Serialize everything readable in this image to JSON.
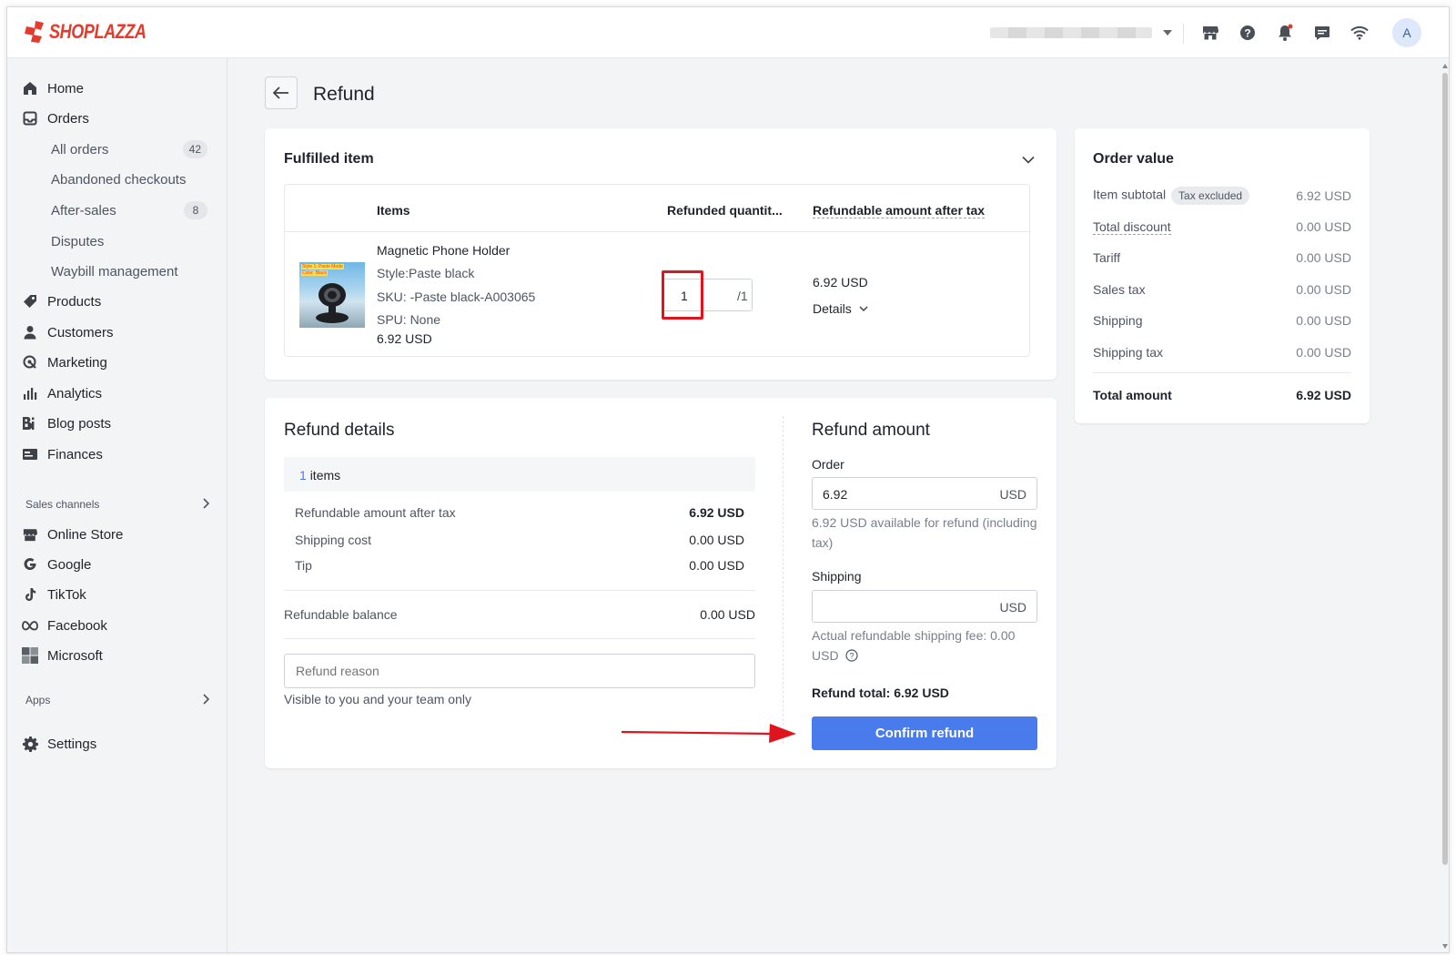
{
  "app": {
    "brand": "SHOPLAZZA",
    "brand_color": "#e33b2e",
    "accent_color": "#4a7bec",
    "avatar_letter": "A"
  },
  "topbar": {
    "icons": [
      "store-icon",
      "help-icon",
      "bell-icon",
      "chat-icon",
      "wifi-icon"
    ]
  },
  "sidebar": {
    "home": "Home",
    "orders": "Orders",
    "all_orders": "All orders",
    "all_orders_count": "42",
    "abandoned": "Abandoned checkouts",
    "after_sales": "After-sales",
    "after_sales_count": "8",
    "disputes": "Disputes",
    "waybill": "Waybill management",
    "products": "Products",
    "customers": "Customers",
    "marketing": "Marketing",
    "analytics": "Analytics",
    "blog": "Blog posts",
    "finances": "Finances",
    "sales_channels": "Sales channels",
    "online_store": "Online Store",
    "google": "Google",
    "tiktok": "TikTok",
    "facebook": "Facebook",
    "microsoft": "Microsoft",
    "apps": "Apps",
    "settings": "Settings"
  },
  "page": {
    "title": "Refund"
  },
  "fulfilled": {
    "title": "Fulfilled item",
    "col_items": "Items",
    "col_qty": "Refunded quantit...",
    "col_amount": "Refundable amount after tax",
    "product_name": "Magnetic Phone Holder",
    "style": "Style:Paste black",
    "sku": "SKU: -Paste black-A003065",
    "spu": "SPU: None",
    "price": "6.92 USD",
    "qty_value": "1",
    "qty_max": "/1",
    "amount": "6.92 USD",
    "details": "Details",
    "img_label_1": "Style 1: Paste Mode",
    "img_label_2": "Color: Black"
  },
  "refund_details": {
    "title": "Refund details",
    "items_count": "1",
    "items_word": "items",
    "rows": [
      {
        "label": "Refundable amount after tax",
        "value": "6.92 USD"
      },
      {
        "label": "Shipping cost",
        "value": "0.00 USD"
      },
      {
        "label": "Tip",
        "value": "0.00 USD"
      }
    ],
    "balance_label": "Refundable balance",
    "balance_value": "0.00 USD",
    "reason_placeholder": "Refund reason",
    "reason_hint": "Visible to you and your team only"
  },
  "refund_amount": {
    "title": "Refund amount",
    "order_label": "Order",
    "order_value": "6.92",
    "currency": "USD",
    "order_hint": "6.92 USD available for refund (including tax)",
    "shipping_label": "Shipping",
    "shipping_hint": "Actual refundable shipping fee: 0.00 USD",
    "total": "Refund total: 6.92 USD",
    "confirm": "Confirm refund"
  },
  "order_value": {
    "title": "Order value",
    "tax_pill": "Tax excluded",
    "rows": [
      {
        "label": "Item subtotal",
        "value": "6.92 USD"
      },
      {
        "label": "Total discount",
        "value": "0.00 USD"
      },
      {
        "label": "Tariff",
        "value": "0.00 USD"
      },
      {
        "label": "Sales tax",
        "value": "0.00 USD"
      },
      {
        "label": "Shipping",
        "value": "0.00 USD"
      },
      {
        "label": "Shipping tax",
        "value": "0.00 USD"
      }
    ],
    "total_label": "Total amount",
    "total_value": "6.92 USD"
  }
}
